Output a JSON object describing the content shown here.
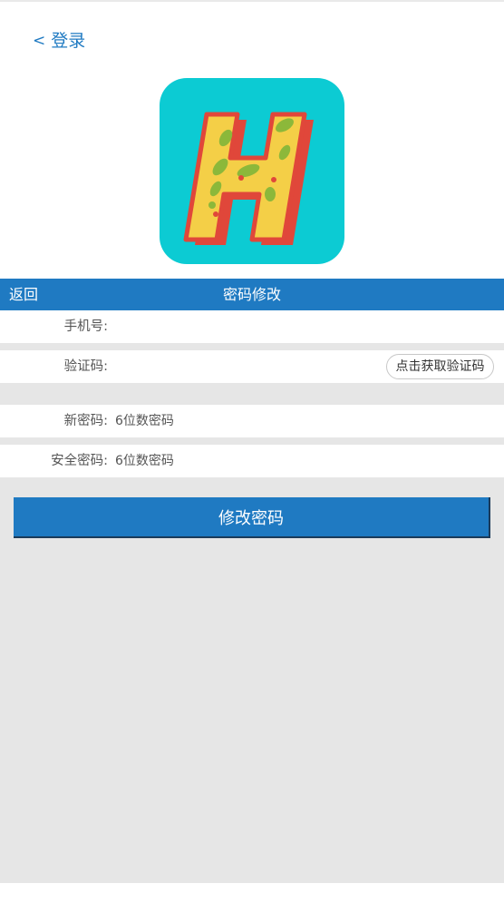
{
  "header": {
    "back_login_icon": "chevron-left-icon",
    "back_login_chevron": "<",
    "back_login_label": "登录",
    "logo_icon": "app-logo-h-icon"
  },
  "navbar": {
    "back_label": "返回",
    "title": "密码修改"
  },
  "form": {
    "phone_label": "手机号:",
    "phone_placeholder": "",
    "code_label": "验证码:",
    "code_placeholder": "",
    "get_code_button": "点击获取验证码",
    "new_password_label": "新密码:",
    "new_password_placeholder": "6位数密码",
    "safe_password_label": "安全密码:",
    "safe_password_placeholder": "6位数密码",
    "submit_label": "修改密码"
  },
  "colors": {
    "accent": "#1f7ac2",
    "logo_bg": "#0ccbd3",
    "logo_letter": "#f4cf47",
    "logo_shadow": "#e0473a",
    "logo_dots": "#8cb83a",
    "page_gray": "#e6e6e6"
  }
}
